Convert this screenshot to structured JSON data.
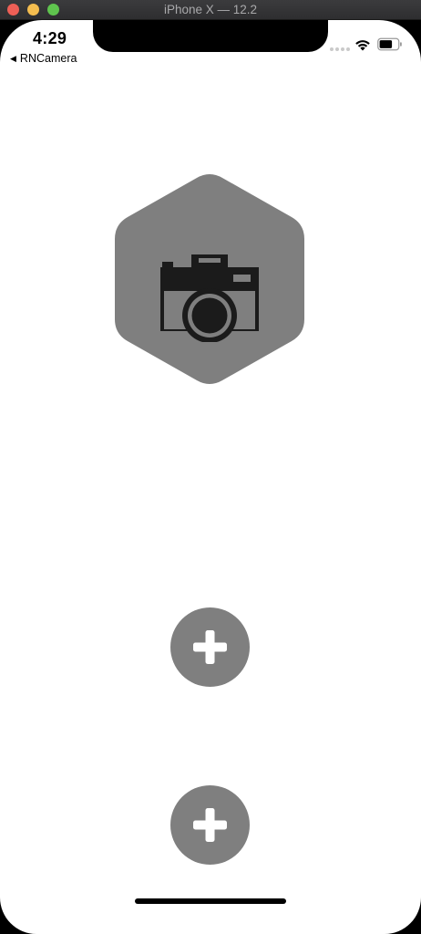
{
  "window": {
    "title": "iPhone X — 12.2"
  },
  "status_bar": {
    "time": "4:29",
    "back_label": "RNCamera"
  },
  "content": {
    "camera_button_icon": "camera-icon",
    "add_buttons": [
      {
        "icon": "plus-icon"
      },
      {
        "icon": "plus-icon"
      }
    ]
  },
  "colors": {
    "button_gray": "#7f7f7f",
    "icon_dark": "#1b1b1b",
    "plus_white": "#ffffff"
  }
}
